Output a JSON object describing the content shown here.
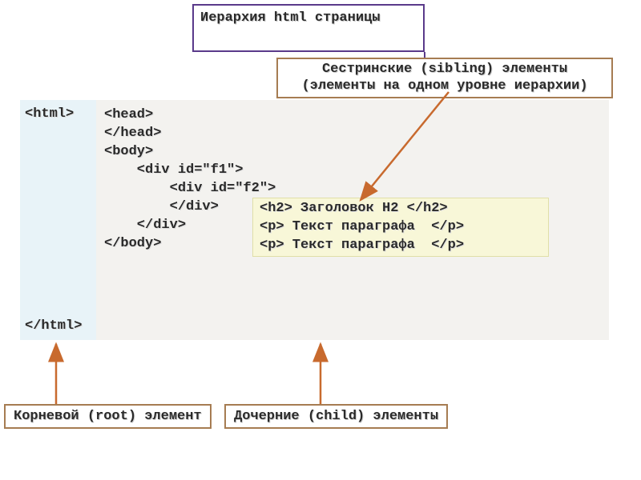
{
  "title": "Иерархия html страницы",
  "labels": {
    "sibling": "Сестринские (sibling) элементы (элементы на одном уровне иерархии)",
    "root": "Корневой (root) элемент",
    "child": "Дочерние (child) элементы"
  },
  "code": {
    "html_open": "<html>",
    "html_close": "</html>",
    "lines": [
      "<head>",
      "</head>",
      "<body>",
      "    <div id=\"f1\">",
      "        <div id=\"f2\">",
      "",
      "",
      "",
      "        </div>",
      "    </div>",
      "</body>"
    ],
    "highlight": [
      "<h2> Заголовок H2 </h2>",
      "<p> Текст параграфа  </p>",
      "<p> Текст параграфа  </p>"
    ]
  }
}
